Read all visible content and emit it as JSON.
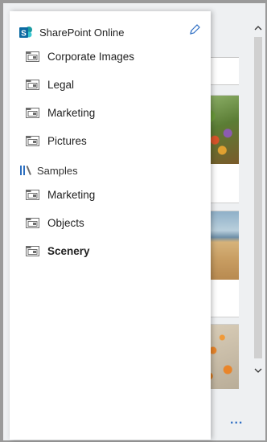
{
  "header": {
    "site_title": "SharePoint Online"
  },
  "site_items": [
    {
      "label": "Corporate Images"
    },
    {
      "label": "Legal"
    },
    {
      "label": "Marketing"
    },
    {
      "label": "Pictures"
    }
  ],
  "group": {
    "label": "Samples",
    "items": [
      {
        "label": "Marketing"
      },
      {
        "label": "Objects"
      },
      {
        "label": "Scenery",
        "selected": true
      }
    ]
  },
  "footer": {
    "more_label": "..."
  },
  "colors": {
    "accent": "#2f6fc4",
    "sharepoint_blue": "#0b6aa2"
  },
  "icons": {
    "site": "sharepoint-logo-icon",
    "edit": "pencil-icon",
    "folder": "folder-icon",
    "group": "library-icon"
  }
}
